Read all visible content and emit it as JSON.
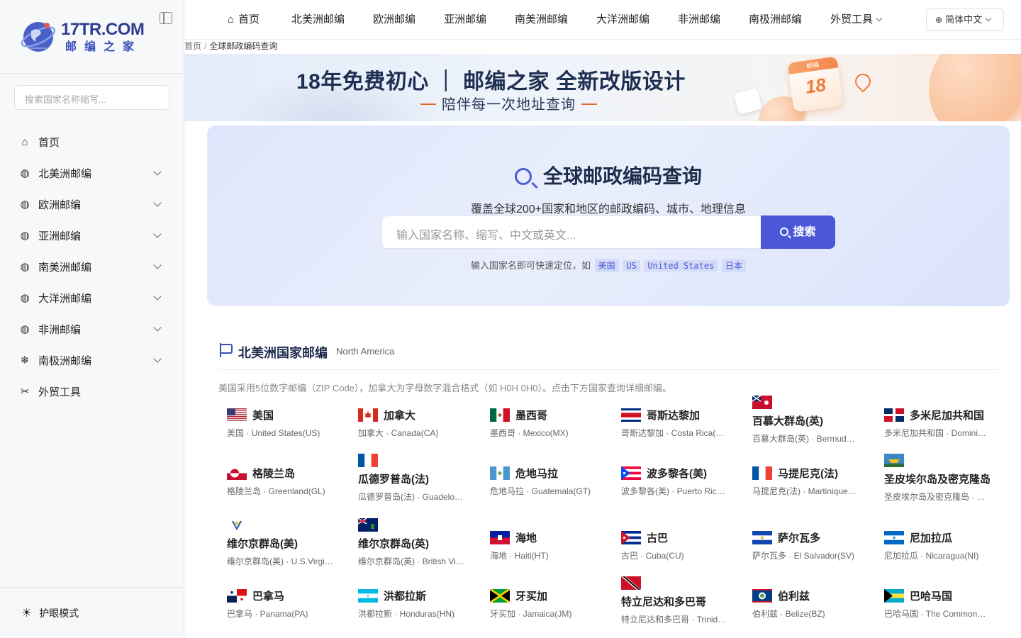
{
  "logo": {
    "title": "17TR.COM",
    "subtitle": "邮编之家"
  },
  "sidebar": {
    "search_placeholder": "搜索国家名称缩写...",
    "items": [
      {
        "label": "首页",
        "icon": "home-icon",
        "has_children": false
      },
      {
        "label": "北美洲邮编",
        "icon": "globe-icon",
        "has_children": true
      },
      {
        "label": "欧洲邮编",
        "icon": "globe-icon",
        "has_children": true
      },
      {
        "label": "亚洲邮编",
        "icon": "globe-icon",
        "has_children": true
      },
      {
        "label": "南美洲邮编",
        "icon": "globe-icon",
        "has_children": true
      },
      {
        "label": "大洋洲邮编",
        "icon": "globe-icon",
        "has_children": true
      },
      {
        "label": "非洲邮编",
        "icon": "globe-icon",
        "has_children": true
      },
      {
        "label": "南极洲邮编",
        "icon": "snowflake-icon",
        "has_children": true
      },
      {
        "label": "外贸工具",
        "icon": "tools-icon",
        "has_children": false
      }
    ],
    "eye_mode": "护眼模式"
  },
  "topnav": {
    "items": [
      "首页",
      "北美洲邮编",
      "欧洲邮编",
      "亚洲邮编",
      "南美洲邮编",
      "大洋洲邮编",
      "非洲邮编",
      "南极洲邮编",
      "外贸工具"
    ],
    "language": "简体中文"
  },
  "breadcrumb": {
    "home": "首页",
    "current": "全球邮政编码查询"
  },
  "banner": {
    "title": "18年免费初心 ｜ 邮编之家 全新改版设计",
    "subtitle": "陪伴每一次地址查询",
    "calendar_top": "邮编",
    "calendar_num": "18"
  },
  "hero": {
    "title": "全球邮政编码查询",
    "description": "覆盖全球200+国家和地区的邮政编码、城市、地理信息",
    "input_placeholder": "输入国家名称、缩写、中文或英文...",
    "button": "搜索",
    "hint": "输入国家名即可快速定位，如",
    "chips": [
      "美国",
      "US",
      "United States",
      "日本"
    ]
  },
  "section": {
    "title": "北美洲国家邮编",
    "subtitle": "North America",
    "description": "美国采用5位数字邮编（ZIP Code），加拿大为字母数字混合格式（如 H0H 0H0）。点击下方国家查询详细邮编。",
    "countries": [
      {
        "name": "美国",
        "sub": "美国 · United States(US)",
        "flag": "us"
      },
      {
        "name": "加拿大",
        "sub": "加拿大 · Canada(CA)",
        "flag": "ca"
      },
      {
        "name": "墨西哥",
        "sub": "墨西哥 · Mexico(MX)",
        "flag": "mx"
      },
      {
        "name": "哥斯达黎加",
        "sub": "哥斯达黎加 · Costa Rica(CR)",
        "flag": "cr"
      },
      {
        "name": "百慕大群岛(英)",
        "sub": "百慕大群岛(英) · Bermuda(BM)",
        "flag": "bm"
      },
      {
        "name": "多米尼加共和国",
        "sub": "多米尼加共和国 · Dominican Republic(DO)",
        "flag": "do"
      },
      {
        "name": "格陵兰岛",
        "sub": "格陵兰岛 · Greenland(GL)",
        "flag": "gl"
      },
      {
        "name": "瓜德罗普岛(法)",
        "sub": "瓜德罗普岛(法) · Guadeloupe(GP)",
        "flag": "fr"
      },
      {
        "name": "危地马拉",
        "sub": "危地马拉 · Guatemala(GT)",
        "flag": "gt"
      },
      {
        "name": "波多黎各(美)",
        "sub": "波多黎各(美) · Puerto Rico(PR)",
        "flag": "pr"
      },
      {
        "name": "马提尼克(法)",
        "sub": "马提尼克(法) · Martinique(MQ)",
        "flag": "fr"
      },
      {
        "name": "圣皮埃尔岛及密克隆岛",
        "sub": "圣皮埃尔岛及密克隆岛 · Saint Pierre and Miquelon(PM)",
        "flag": "pm"
      },
      {
        "name": "维尔京群岛(美)",
        "sub": "维尔京群岛(美) · U.S.Virgin Islands(VI)",
        "flag": "vi"
      },
      {
        "name": "维尔京群岛(英)",
        "sub": "维尔京群岛(英) · British Virgin Islands(VG)",
        "flag": "vg"
      },
      {
        "name": "海地",
        "sub": "海地 · Haiti(HT)",
        "flag": "ht"
      },
      {
        "name": "古巴",
        "sub": "古巴 · Cuba(CU)",
        "flag": "cu"
      },
      {
        "name": "萨尔瓦多",
        "sub": "萨尔瓦多 · El Salvador(SV)",
        "flag": "sv"
      },
      {
        "name": "尼加拉瓜",
        "sub": "尼加拉瓜 · Nicaragua(NI)",
        "flag": "ni"
      },
      {
        "name": "巴拿马",
        "sub": "巴拿马 · Panama(PA)",
        "flag": "pa"
      },
      {
        "name": "洪都拉斯",
        "sub": "洪都拉斯 · Honduras(HN)",
        "flag": "hn"
      },
      {
        "name": "牙买加",
        "sub": "牙买加 · Jamaica(JM)",
        "flag": "jm"
      },
      {
        "name": "特立尼达和多巴哥",
        "sub": "特立尼达和多巴哥 · Trinidad and Tobago(TT)",
        "flag": "tt"
      },
      {
        "name": "伯利兹",
        "sub": "伯利兹 · Belize(BZ)",
        "flag": "bz"
      },
      {
        "name": "巴哈马国",
        "sub": "巴哈马国 · The Commonwealth of The Bahamas(BS)",
        "flag": "bs"
      }
    ]
  },
  "colors": {
    "accent": "#4b57d6",
    "brand": "#2f3f8f",
    "banner_orange": "#f07a3a"
  }
}
